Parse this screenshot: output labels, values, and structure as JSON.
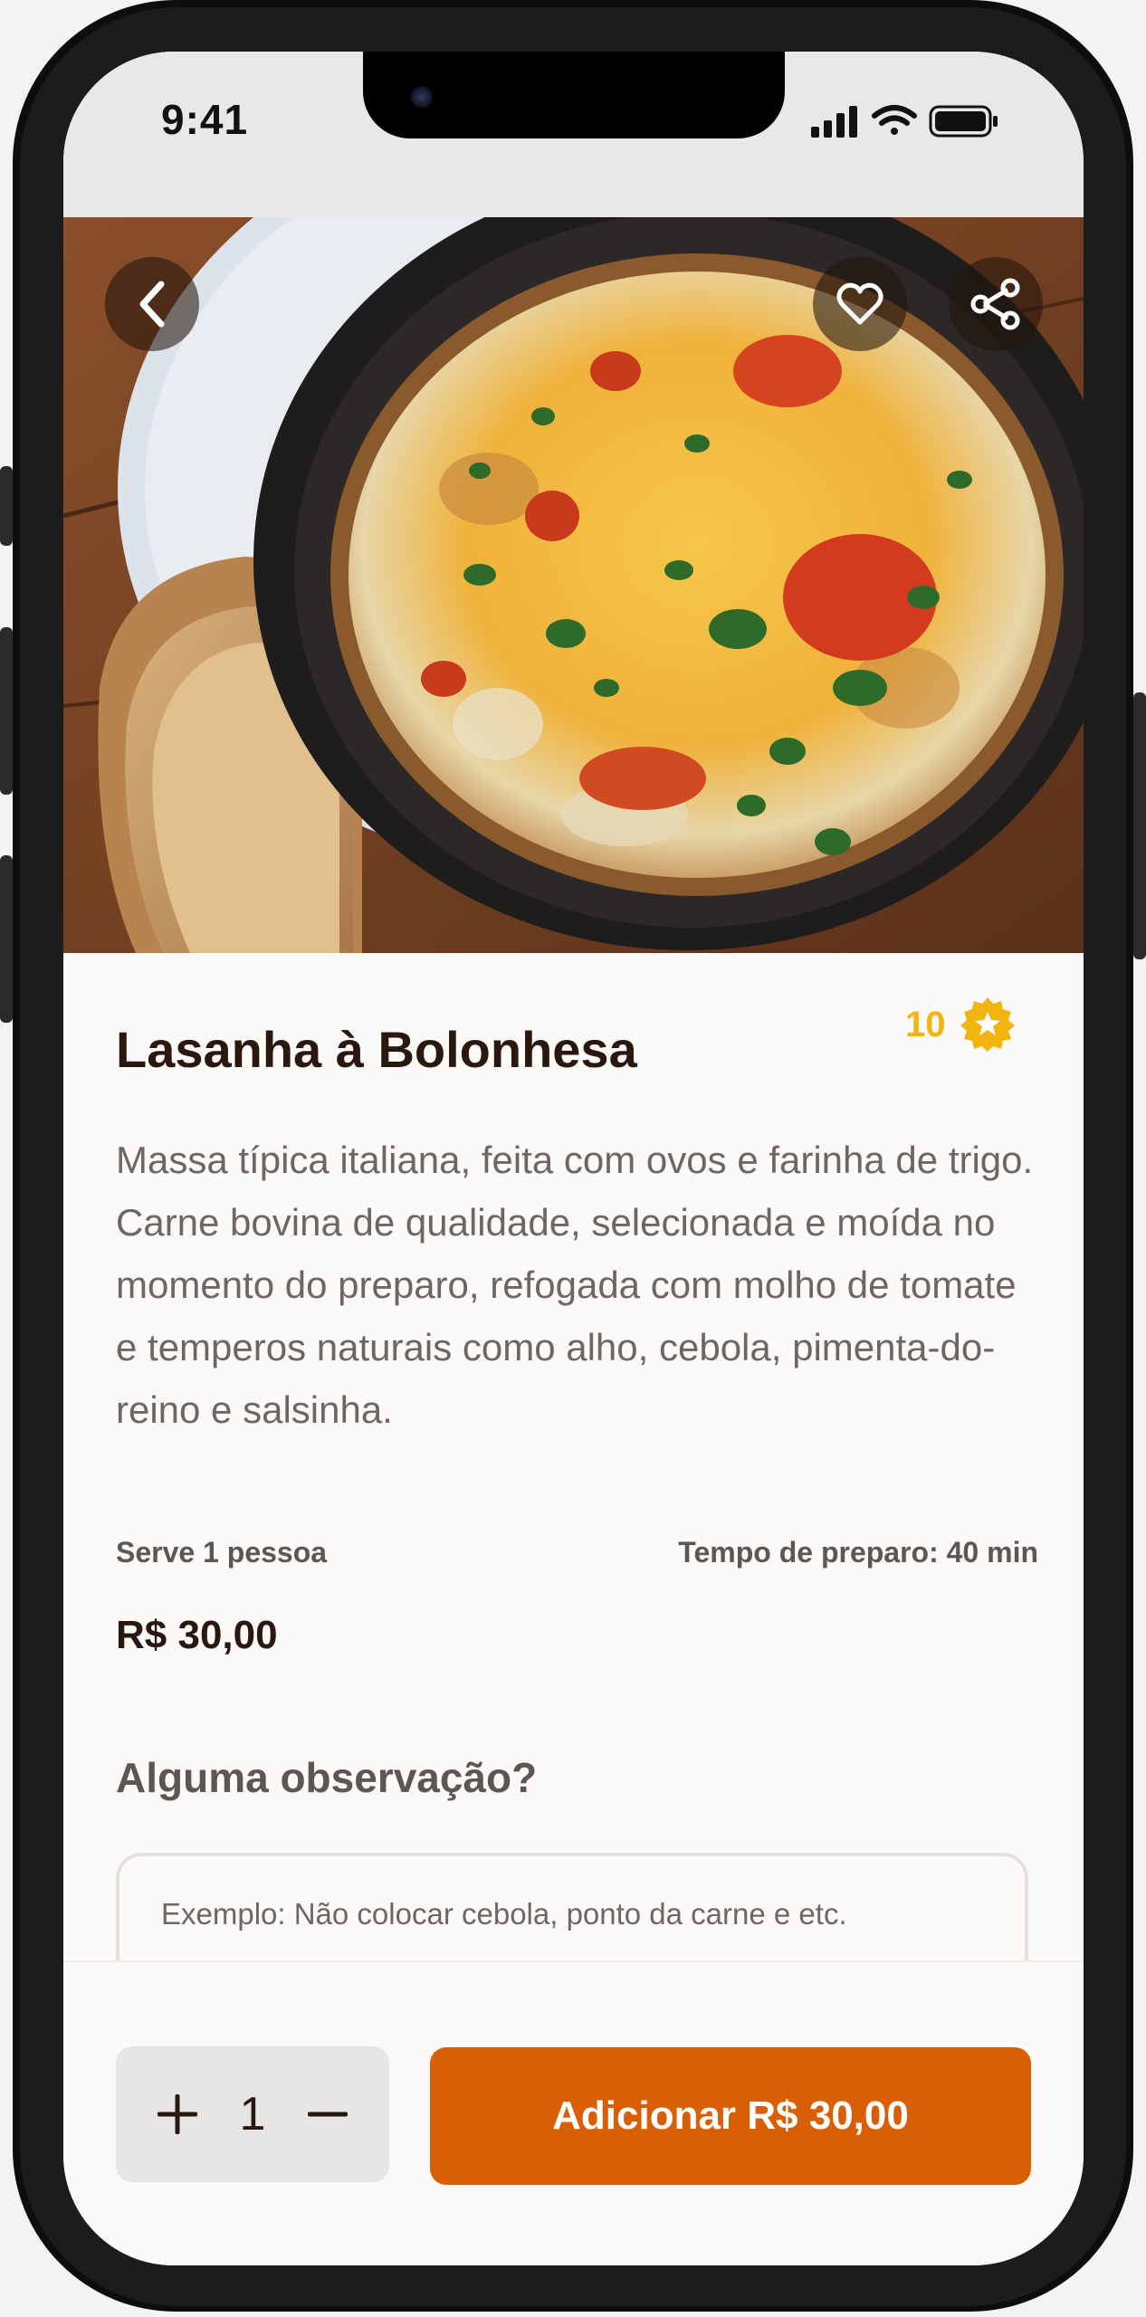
{
  "status_bar": {
    "time": "9:41"
  },
  "product": {
    "title": "Lasanha à Bolonhesa",
    "rating": "10",
    "description": "Massa típica italiana, feita com ovos e farinha de trigo. Carne bovina de qualidade, selecionada e moída no momento do preparo, refogada com molho de tomate e temperos naturais como alho, cebola, pimenta-do-reino e salsinha.",
    "serves": "Serve 1 pessoa",
    "prep_time": "Tempo de preparo: 40 min",
    "price": "R$ 30,00"
  },
  "notes": {
    "label": "Alguma observação?",
    "placeholder": "Exemplo: Não colocar cebola, ponto da carne e etc."
  },
  "cart": {
    "quantity": "1",
    "add_button_label": "Adicionar R$ 30,00"
  },
  "icons": [
    "back-arrow-icon",
    "heart-icon",
    "share-icon",
    "star-badge-icon",
    "plus-icon",
    "minus-icon",
    "signal-icon",
    "wifi-icon",
    "battery-icon"
  ],
  "colors": {
    "accent": "#d95f06",
    "rating": "#f2b40f",
    "title": "#2a1810",
    "body_text": "#6d6664"
  }
}
